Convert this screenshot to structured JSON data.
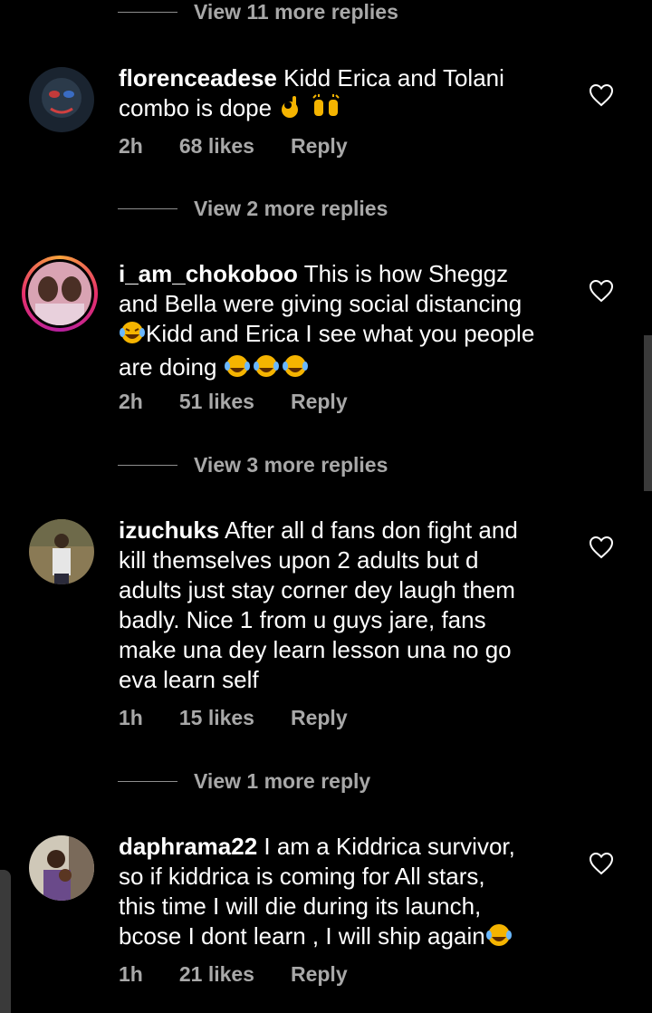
{
  "threads": [
    {
      "view_more": "View 11 more replies"
    },
    {
      "username": "florenceadese",
      "lines": [
        "Kidd Erica and Tolani",
        "combo is dope"
      ],
      "time": "2h",
      "likes": "68 likes",
      "reply": "Reply",
      "view_more": "View 2 more replies"
    },
    {
      "username": "i_am_chokoboo",
      "lines": [
        "This is how Sheggz",
        "and Bella were giving social distancing",
        "Kidd and Erica I see what you people",
        "are doing"
      ],
      "time": "2h",
      "likes": "51 likes",
      "reply": "Reply",
      "view_more": "View 3 more replies"
    },
    {
      "username": "izuchuks",
      "lines": [
        "After all d fans don fight and",
        "kill themselves upon 2 adults but d",
        "adults just stay corner dey laugh them",
        "badly. Nice 1 from u guys jare, fans",
        "make una dey learn lesson una no go",
        "eva learn self"
      ],
      "time": "1h",
      "likes": "15 likes",
      "reply": "Reply",
      "view_more": "View 1 more reply"
    },
    {
      "username": "daphrama22",
      "lines": [
        "I am a Kiddrica survivor,",
        "so if kiddrica is coming for All stars,",
        "this time I will die  during its launch,",
        "bcose I dont learn , I will ship again"
      ],
      "time": "1h",
      "likes": "21 likes",
      "reply": "Reply"
    }
  ],
  "icons": {
    "like": "heart-outline-icon",
    "ok_hand": "ok-hand-emoji",
    "raised_hands": "raising-hands-emoji",
    "laughing": "tears-of-joy-emoji"
  },
  "colors": {
    "background": "#000000",
    "meta": "#a8a8a8",
    "ring": "#e7306b"
  }
}
